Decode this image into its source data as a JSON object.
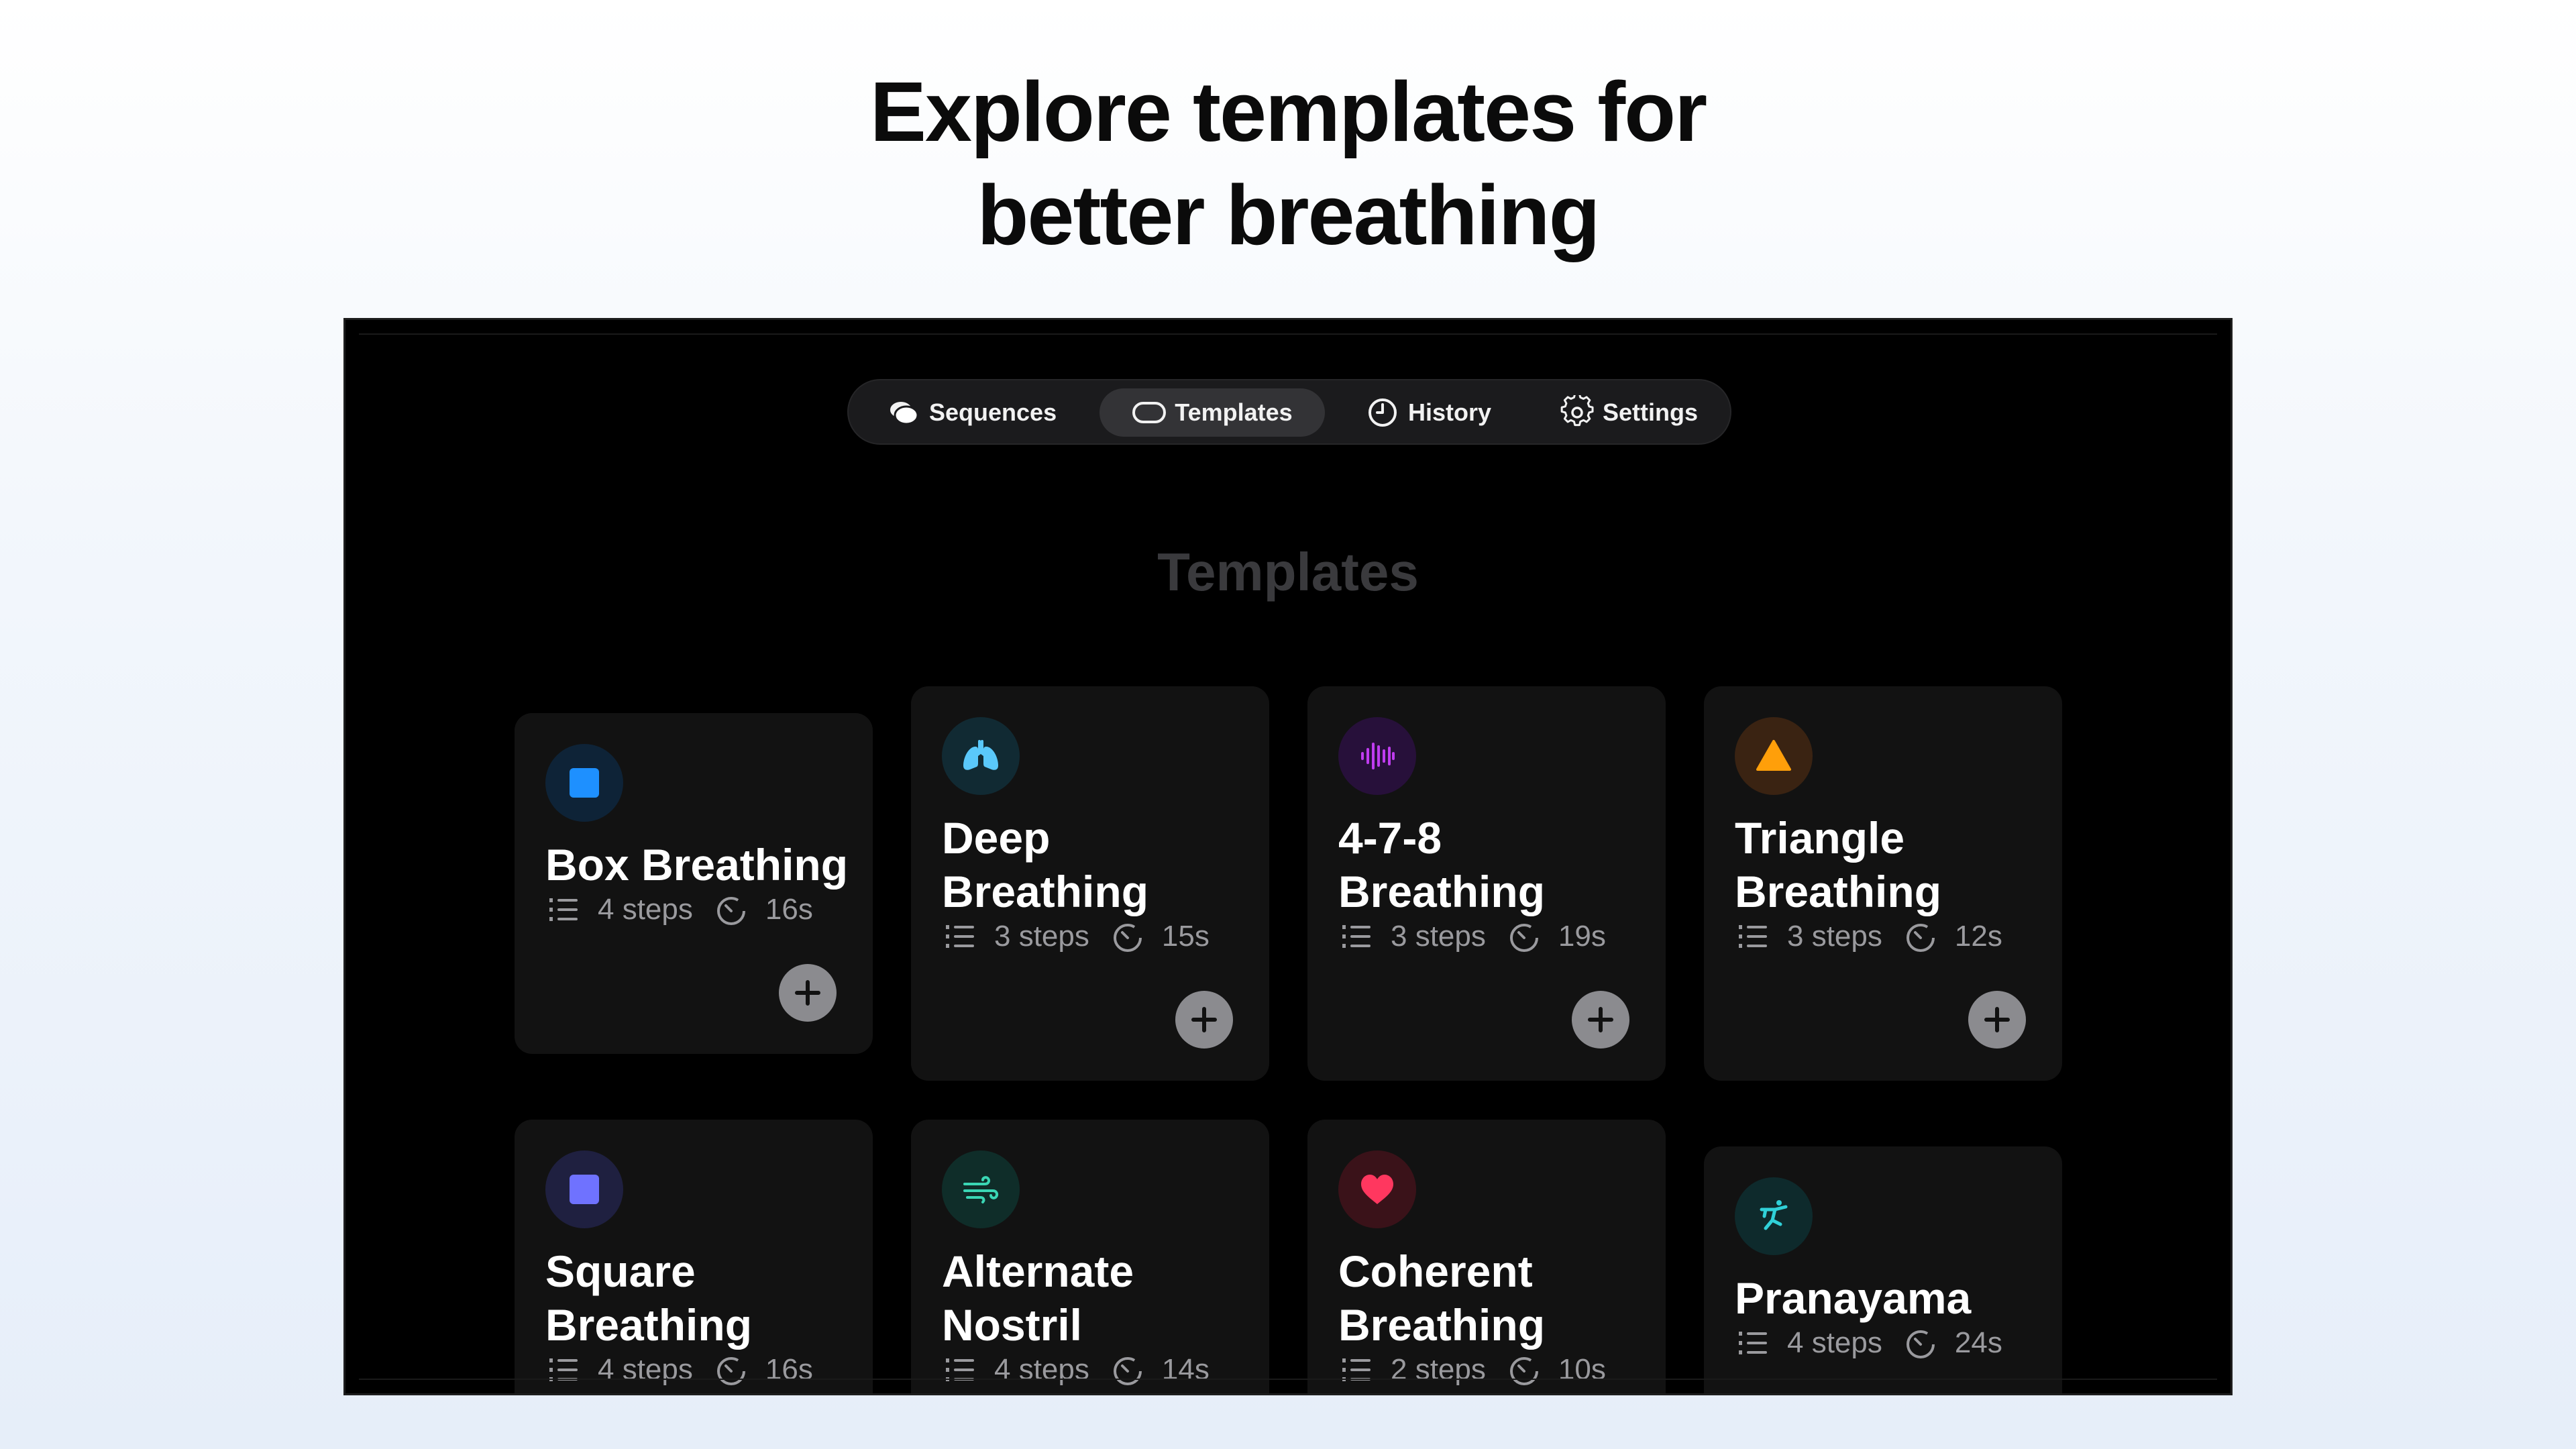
{
  "headline": {
    "line1": "Explore templates for",
    "line2": "better breathing"
  },
  "nav": {
    "items": [
      {
        "label": "Sequences",
        "icon": "bubbles-icon",
        "active": false
      },
      {
        "label": "Templates",
        "icon": "capsule-icon",
        "active": true
      },
      {
        "label": "History",
        "icon": "clock-icon",
        "active": false
      },
      {
        "label": "Settings",
        "icon": "gear-icon",
        "active": false
      }
    ]
  },
  "section": {
    "title": "Templates"
  },
  "templates": [
    {
      "title": "Box Breathing",
      "steps": "4 steps",
      "duration": "16s",
      "icon": "square-icon",
      "color": "#1e90ff",
      "icon_bg": "#0e2337"
    },
    {
      "title": "Deep Breathing",
      "steps": "3 steps",
      "duration": "15s",
      "icon": "lungs-icon",
      "color": "#5ac8fa",
      "icon_bg": "#112a33"
    },
    {
      "title": "4-7-8 Breathing",
      "steps": "3 steps",
      "duration": "19s",
      "icon": "waveform-icon",
      "color": "#c03cf0",
      "icon_bg": "#27103a"
    },
    {
      "title": "Triangle Breathing",
      "steps": "3 steps",
      "duration": "12s",
      "icon": "triangle-icon",
      "color": "#ff9f0a",
      "icon_bg": "#3a2312"
    },
    {
      "title": "Square Breathing",
      "steps": "4 steps",
      "duration": "16s",
      "icon": "square-icon",
      "color": "#6f72ff",
      "icon_bg": "#1f2040"
    },
    {
      "title": "Alternate Nostril",
      "steps": "4 steps",
      "duration": "14s",
      "icon": "wind-icon",
      "color": "#3ad6b4",
      "icon_bg": "#0f2d29"
    },
    {
      "title": "Coherent Breathing",
      "steps": "2 steps",
      "duration": "10s",
      "icon": "heart-icon",
      "color": "#ff375f",
      "icon_bg": "#3a1219"
    },
    {
      "title": "Pranayama",
      "steps": "4 steps",
      "duration": "24s",
      "icon": "yoga-icon",
      "color": "#30d0d8",
      "icon_bg": "#0e2a2c"
    }
  ]
}
